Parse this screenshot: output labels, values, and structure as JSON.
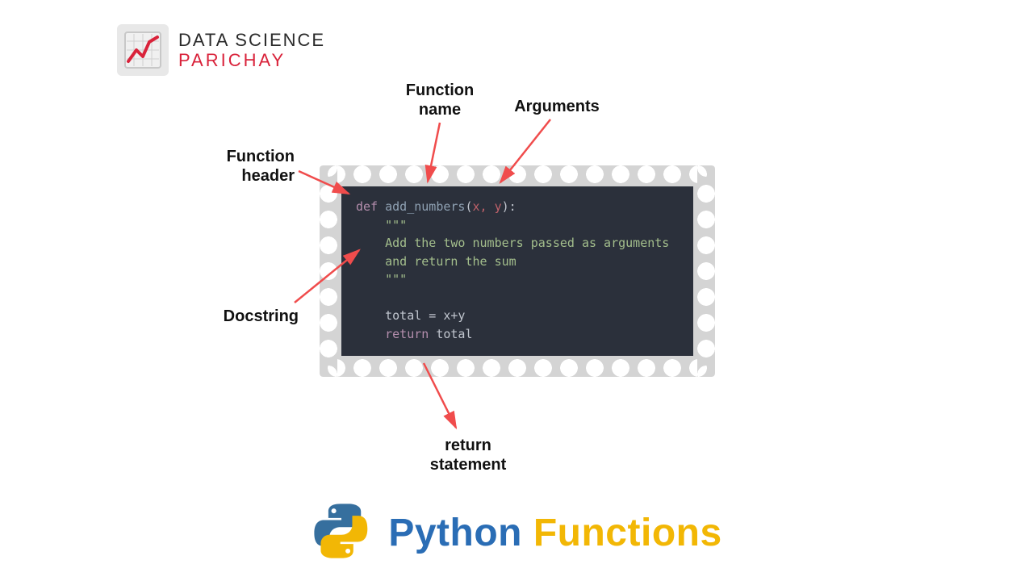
{
  "logo": {
    "line1": "DATA SCIENCE",
    "line2": "PARICHAY"
  },
  "labels": {
    "function_name": "Function\nname",
    "arguments": "Arguments",
    "function_header": "Function\nheader",
    "docstring": "Docstring",
    "return_statement": "return\nstatement"
  },
  "code": {
    "keyword_def": "def",
    "func_name": "add_numbers",
    "params": "x, y",
    "doc_open": "\"\"\"",
    "doc_line1": "Add the two numbers passed as arguments",
    "doc_line2": "and return the sum",
    "doc_close": "\"\"\"",
    "assign": "total = x+y",
    "keyword_return": "return",
    "return_var": "total"
  },
  "title": {
    "part1": "Python",
    "part2": "Functions"
  },
  "colors": {
    "accent_red": "#d9223a",
    "arrow": "#f04c4c",
    "code_bg": "#2b303b",
    "blue": "#2a6db5",
    "yellow": "#f2b705"
  }
}
